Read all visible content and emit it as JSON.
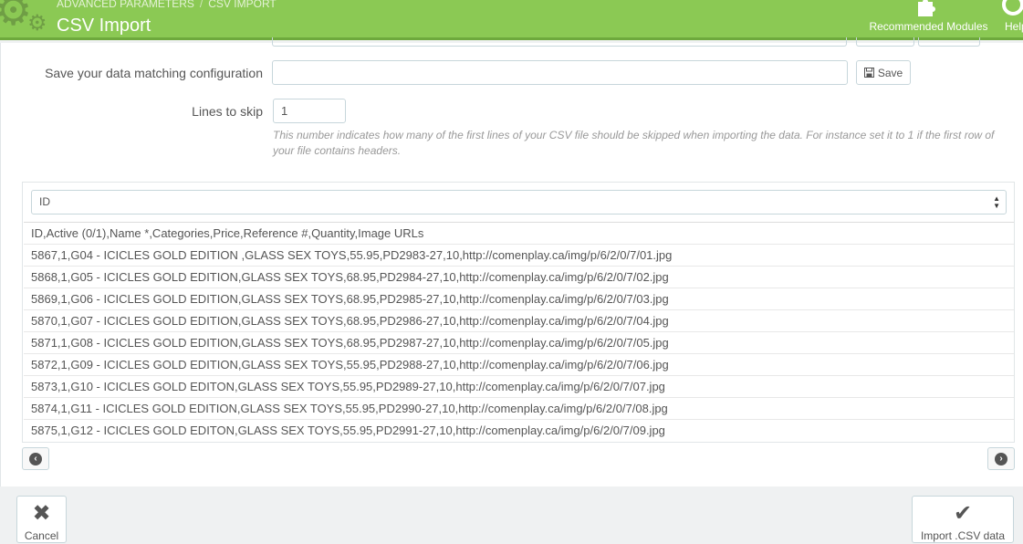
{
  "header": {
    "breadcrumb": [
      "ADVANCED PARAMETERS",
      "CSV IMPORT"
    ],
    "breadcrumb_sep": "/",
    "title": "CSV Import",
    "toolbar": {
      "modules_label": "Recommended Modules",
      "help_label": "Help"
    },
    "colors": {
      "bar": "#8bc954",
      "bar_border": "#6ea93d"
    }
  },
  "form": {
    "matching_label": "Save your data matching configuration",
    "matching_value": "",
    "save_label": "Save",
    "skip_label": "Lines to skip",
    "skip_value": "1",
    "skip_hint": "This number indicates how many of the first lines of your CSV file should be skipped when importing the data. For instance set it to 1 if the first row of your file contains headers."
  },
  "matching": {
    "selected_field": "ID",
    "rows": [
      "ID,Active (0/1),Name *,Categories,Price,Reference #,Quantity,Image URLs",
      "5867,1,G04 - ICICLES GOLD EDITION ,GLASS SEX TOYS,55.95,PD2983-27,10,http://comenplay.ca/img/p/6/2/0/7/01.jpg",
      "5868,1,G05 - ICICLES GOLD EDITION,GLASS SEX TOYS,68.95,PD2984-27,10,http://comenplay.ca/img/p/6/2/0/7/02.jpg",
      "5869,1,G06 - ICICLES GOLD EDITION,GLASS SEX TOYS,68.95,PD2985-27,10,http://comenplay.ca/img/p/6/2/0/7/03.jpg",
      "5870,1,G07 - ICICLES GOLD EDITION,GLASS SEX TOYS,68.95,PD2986-27,10,http://comenplay.ca/img/p/6/2/0/7/04.jpg",
      "5871,1,G08 - ICICLES GOLD EDITION,GLASS SEX TOYS,68.95,PD2987-27,10,http://comenplay.ca/img/p/6/2/0/7/05.jpg",
      "5872,1,G09 - ICICLES GOLD EDITION,GLASS SEX TOYS,55.95,PD2988-27,10,http://comenplay.ca/img/p/6/2/0/7/06.jpg",
      "5873,1,G10 - ICICLES GOLD EDITON,GLASS SEX TOYS,55.95,PD2989-27,10,http://comenplay.ca/img/p/6/2/0/7/07.jpg",
      "5874,1,G11 - ICICLES GOLD EDITION,GLASS SEX TOYS,55.95,PD2990-27,10,http://comenplay.ca/img/p/6/2/0/7/08.jpg",
      "5875,1,G12 - ICICLES GOLD EDITON,GLASS SEX TOYS,55.95,PD2991-27,10,http://comenplay.ca/img/p/6/2/0/7/09.jpg"
    ]
  },
  "footer": {
    "cancel_label": "Cancel",
    "import_label": "Import .CSV data"
  }
}
